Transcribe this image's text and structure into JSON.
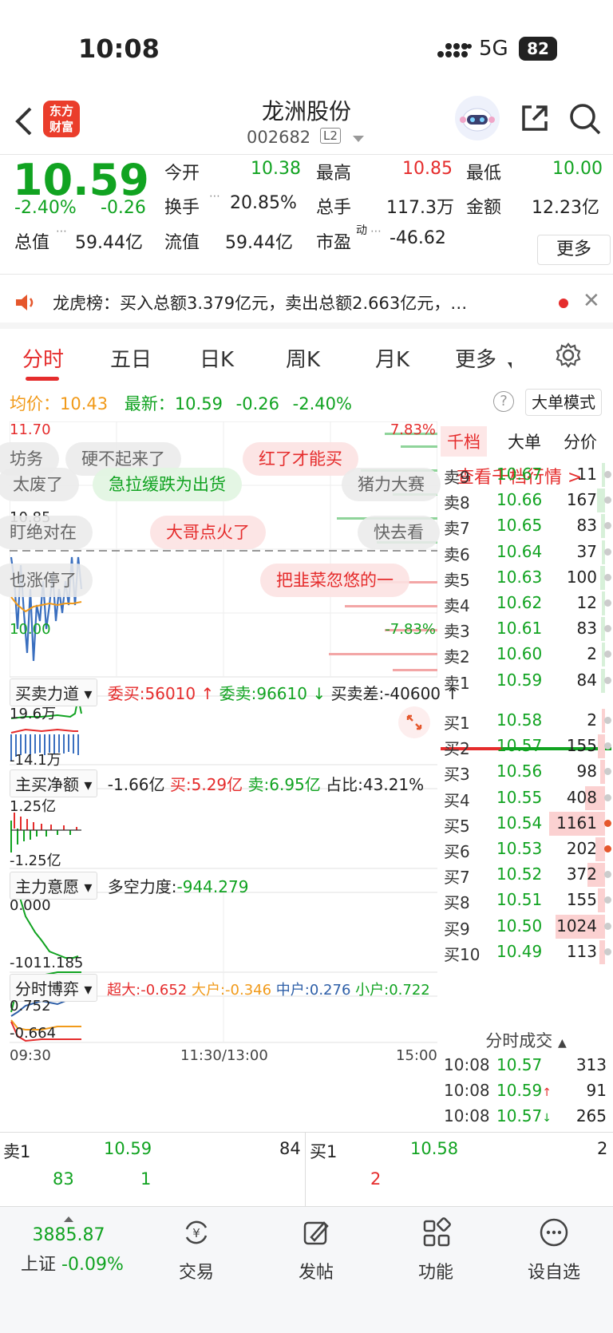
{
  "status_bar": {
    "time": "10:08",
    "network": "5G",
    "battery": "82"
  },
  "header": {
    "logo_text_1": "东方",
    "logo_text_2": "财富",
    "stock_name": "龙洲股份",
    "stock_code": "002682",
    "level_badge": "L2"
  },
  "quote": {
    "price": "10.59",
    "change_pct": "-2.40%",
    "change": "-0.26",
    "open_label": "今开",
    "open": "10.38",
    "high_label": "最高",
    "high": "10.85",
    "low_label": "最低",
    "low": "10.00",
    "turnover_label": "换手",
    "turnover": "20.85%",
    "volume_label": "总手",
    "volume": "117.3万",
    "amount_label": "金额",
    "amount": "12.23亿",
    "total_mv_label": "总值",
    "total_mv": "59.44亿",
    "float_mv_label": "流值",
    "float_mv": "59.44亿",
    "pe_label": "市盈",
    "pe_sup": "动",
    "pe": "-46.62",
    "more_label": "更多"
  },
  "notice": {
    "text": "龙虎榜：买入总额3.379亿元，卖出总额2.663亿元，…"
  },
  "tabs": [
    "分时",
    "五日",
    "日K",
    "周K",
    "月K",
    "更多"
  ],
  "summary": {
    "avg_label": "均价：",
    "avg": "10.43",
    "latest_label": "最新：",
    "latest": "10.59",
    "change": "-0.26",
    "change_pct": "-2.40%",
    "mode_button": "大单模式"
  },
  "price_chart": {
    "top_price": "11.70",
    "bottom_price": "10.00",
    "top_pct": "7.83%",
    "bottom_pct": "-7.83%",
    "ref_price": "10.85"
  },
  "danmu": [
    "坊务",
    "硬不起来了",
    "红了才能买",
    "太废了",
    "急拉缓跌为出货",
    "猪力大赛",
    "盯绝对在",
    "大哥点火了",
    "快去看",
    "也涨停了",
    "把韭菜忽悠的一"
  ],
  "indicators": {
    "buy_sell_power": {
      "name": "买卖力道",
      "wei_buy": "委买:56010 ↑",
      "wei_sell": "委卖:96610 ↓",
      "diff": "买卖差:-40600 ↑",
      "top": "19.6万",
      "bottom": "-14.1万"
    },
    "main_net": {
      "name": "主买净额",
      "net": "-1.66亿",
      "buy": "买:5.29亿",
      "sell": "卖:6.95亿",
      "ratio": "占比:43.21%",
      "top": "1.25亿",
      "bottom": "-1.25亿"
    },
    "main_will": {
      "name": "主力意愿",
      "label": "多空力度:",
      "value": "-944.279",
      "top": "0.000",
      "bottom": "-1011.185"
    },
    "intraday_game": {
      "name": "分时博弈",
      "super": "超大:-0.652",
      "large": "大户:-0.346",
      "mid": "中户:0.276",
      "small": "小户:0.722",
      "top": "0.752",
      "bottom": "-0.664"
    }
  },
  "time_axis": [
    "09:30",
    "11:30/13:00",
    "15:00"
  ],
  "orderbook": {
    "tabs": [
      "千档",
      "大单",
      "分价"
    ],
    "link": "查看千档行情 >",
    "sells": [
      {
        "label": "卖9",
        "price": "10.67",
        "vol": "11"
      },
      {
        "label": "卖8",
        "price": "10.66",
        "vol": "167"
      },
      {
        "label": "卖7",
        "price": "10.65",
        "vol": "83"
      },
      {
        "label": "卖6",
        "price": "10.64",
        "vol": "37"
      },
      {
        "label": "卖5",
        "price": "10.63",
        "vol": "100"
      },
      {
        "label": "卖4",
        "price": "10.62",
        "vol": "12"
      },
      {
        "label": "卖3",
        "price": "10.61",
        "vol": "83"
      },
      {
        "label": "卖2",
        "price": "10.60",
        "vol": "2"
      },
      {
        "label": "卖1",
        "price": "10.59",
        "vol": "84"
      }
    ],
    "buys": [
      {
        "label": "买1",
        "price": "10.58",
        "vol": "2"
      },
      {
        "label": "买2",
        "price": "10.57",
        "vol": "155"
      },
      {
        "label": "买3",
        "price": "10.56",
        "vol": "98"
      },
      {
        "label": "买4",
        "price": "10.55",
        "vol": "408"
      },
      {
        "label": "买5",
        "price": "10.54",
        "vol": "1161"
      },
      {
        "label": "买6",
        "price": "10.53",
        "vol": "202"
      },
      {
        "label": "买7",
        "price": "10.52",
        "vol": "372"
      },
      {
        "label": "买8",
        "price": "10.51",
        "vol": "155"
      },
      {
        "label": "买9",
        "price": "10.50",
        "vol": "1024"
      },
      {
        "label": "买10",
        "price": "10.49",
        "vol": "113"
      }
    ],
    "ticks_title": "分时成交",
    "ticks": [
      {
        "time": "10:08",
        "price": "10.57",
        "arrow": "",
        "vol": "313"
      },
      {
        "time": "10:08",
        "price": "10.59",
        "arrow": "↑",
        "vol": "91"
      },
      {
        "time": "10:08",
        "price": "10.57",
        "arrow": "↓",
        "vol": "265"
      }
    ]
  },
  "bottom_strip": {
    "sell_label": "卖1",
    "sell_price": "10.59",
    "sell_vol": "84",
    "sell_sub1": "83",
    "sell_sub2": "1",
    "buy_label": "买1",
    "buy_price": "10.58",
    "buy_vol": "2",
    "buy_sub1": "2"
  },
  "tabbar": {
    "index_value": "3885.87",
    "index_name": "上证",
    "index_change": "-0.09%",
    "trade": "交易",
    "post": "发帖",
    "functions": "功能",
    "watchlist": "设自选"
  }
}
